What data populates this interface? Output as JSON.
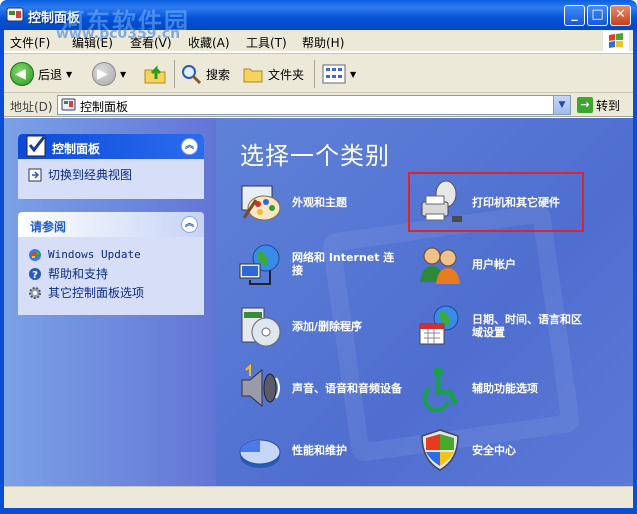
{
  "window": {
    "title": "控制面板",
    "watermark": "河东软件园",
    "watermark_url": "www.pc0359.cn"
  },
  "menu": [
    "文件(F)",
    "编辑(E)",
    "查看(V)",
    "收藏(A)",
    "工具(T)",
    "帮助(H)"
  ],
  "toolbar": {
    "back_label": "后退",
    "search_label": "搜索",
    "folders_label": "文件夹"
  },
  "address": {
    "label": "地址(D)",
    "value": "控制面板",
    "go_label": "转到"
  },
  "sidebar": {
    "panel1": {
      "title": "控制面板",
      "links": [
        {
          "label": "切换到经典视图",
          "icon": "switch-view-icon"
        }
      ]
    },
    "panel2": {
      "title": "请参阅",
      "links": [
        {
          "label": "Windows Update",
          "icon": "windows-update-icon"
        },
        {
          "label": "帮助和支持",
          "icon": "help-icon"
        },
        {
          "label": "其它控制面板选项",
          "icon": "gear-icon"
        }
      ]
    }
  },
  "main": {
    "heading": "选择一个类别",
    "categories": [
      {
        "label": "外观和主题",
        "icon": "palette-icon"
      },
      {
        "label": "打印机和其它硬件",
        "icon": "printer-icon",
        "highlighted": true
      },
      {
        "label": "网络和 Internet 连接",
        "icon": "globe-network-icon"
      },
      {
        "label": "用户帐户",
        "icon": "users-icon"
      },
      {
        "label": "添加/删除程序",
        "icon": "cd-box-icon"
      },
      {
        "label": "日期、时间、语言和区域设置",
        "icon": "calendar-globe-icon"
      },
      {
        "label": "声音、语音和音频设备",
        "icon": "speaker-icon"
      },
      {
        "label": "辅助功能选项",
        "icon": "accessibility-icon"
      },
      {
        "label": "性能和维护",
        "icon": "pie-chart-icon"
      },
      {
        "label": "安全中心",
        "icon": "shield-icon"
      }
    ]
  },
  "colors": {
    "highlight_border": "#e0222a",
    "content_background": "#5a7edc",
    "titlebar": "#0453d8"
  }
}
